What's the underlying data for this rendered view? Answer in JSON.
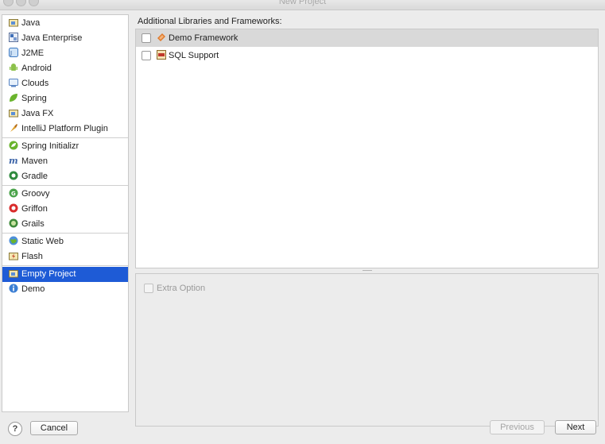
{
  "window": {
    "title": "New Project"
  },
  "sidebar": {
    "groups": [
      [
        {
          "label": "Java",
          "icon": "java-folder-icon"
        },
        {
          "label": "Java Enterprise",
          "icon": "java-enterprise-icon"
        },
        {
          "label": "J2ME",
          "icon": "j2me-icon"
        },
        {
          "label": "Android",
          "icon": "android-icon"
        },
        {
          "label": "Clouds",
          "icon": "clouds-icon"
        },
        {
          "label": "Spring",
          "icon": "spring-leaf-icon"
        },
        {
          "label": "Java FX",
          "icon": "javafx-folder-icon"
        },
        {
          "label": "IntelliJ Platform Plugin",
          "icon": "plugin-icon"
        }
      ],
      [
        {
          "label": "Spring Initializr",
          "icon": "spring-initializr-icon"
        },
        {
          "label": "Maven",
          "icon": "maven-icon"
        },
        {
          "label": "Gradle",
          "icon": "gradle-icon"
        }
      ],
      [
        {
          "label": "Groovy",
          "icon": "groovy-icon"
        },
        {
          "label": "Griffon",
          "icon": "griffon-icon"
        },
        {
          "label": "Grails",
          "icon": "grails-icon"
        }
      ],
      [
        {
          "label": "Static Web",
          "icon": "globe-icon"
        },
        {
          "label": "Flash",
          "icon": "flash-icon"
        }
      ],
      [
        {
          "label": "Empty Project",
          "icon": "empty-project-folder-icon",
          "selected": true
        },
        {
          "label": "Demo",
          "icon": "info-icon"
        }
      ]
    ]
  },
  "libraries": {
    "title": "Additional Libraries and Frameworks:",
    "items": [
      {
        "label": "Demo Framework",
        "checked": false,
        "icon": "demo-framework-icon",
        "highlighted": true
      },
      {
        "label": "SQL Support",
        "checked": false,
        "icon": "sql-icon"
      }
    ]
  },
  "options": {
    "extra_option_label": "Extra Option",
    "extra_option_enabled": false
  },
  "footer": {
    "help_label": "?",
    "cancel_label": "Cancel",
    "previous_label": "Previous",
    "next_label": "Next"
  },
  "colors": {
    "selection": "#1e5bd6",
    "highlight_row": "#d9d9d9"
  }
}
